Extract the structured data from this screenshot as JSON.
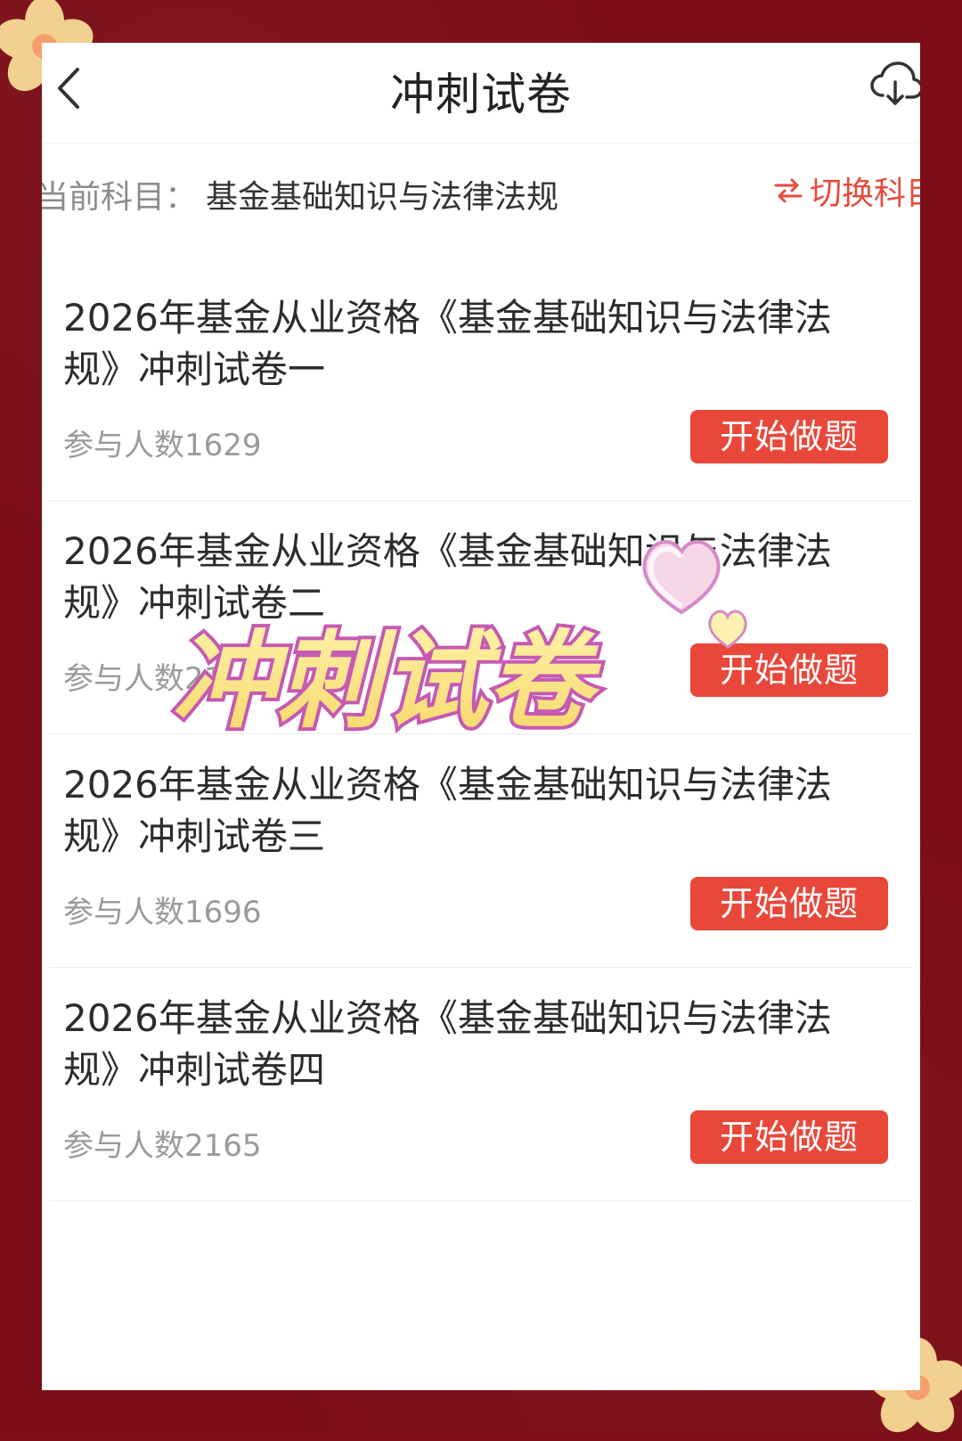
{
  "header": {
    "title": "冲刺试卷",
    "back_icon": "chevron-left-icon",
    "download_icon": "cloud-download-icon"
  },
  "subject": {
    "label": "当前科目：",
    "value": "基金基础知识与法律法规",
    "switch_label": "切换科目",
    "switch_icon": "swap-icon"
  },
  "items": [
    {
      "title": "2026年基金从业资格《基金基础知识与法律法规》冲刺试卷一",
      "participants": "参与人数1629",
      "button_label": "开始做题"
    },
    {
      "title": "2026年基金从业资格《基金基础知识与法律法规》冲刺试卷二",
      "participants": "参与人数21",
      "button_label": "开始做题"
    },
    {
      "title": "2026年基金从业资格《基金基础知识与法律法规》冲刺试卷三",
      "participants": "参与人数1696",
      "button_label": "开始做题"
    },
    {
      "title": "2026年基金从业资格《基金基础知识与法律法规》冲刺试卷四",
      "participants": "参与人数2165",
      "button_label": "开始做题"
    }
  ],
  "overlay": {
    "text": "冲刺试卷",
    "heart_icons": [
      "heart-icon",
      "heart-icon"
    ]
  },
  "colors": {
    "accent": "#e8473a",
    "background_frame": "#7b0e17",
    "text_primary": "#2c2c2c",
    "text_secondary": "#9a9a9a"
  }
}
